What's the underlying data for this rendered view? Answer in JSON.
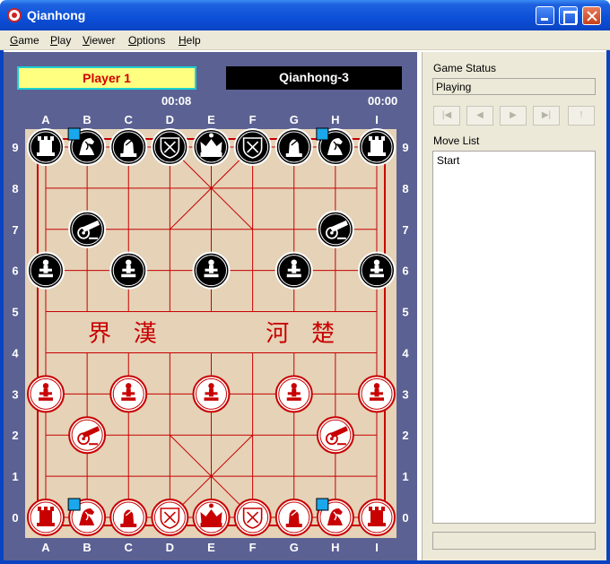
{
  "window": {
    "title": "Qianhong"
  },
  "menu": [
    {
      "pre": "",
      "key": "G",
      "post": "ame"
    },
    {
      "pre": "",
      "key": "P",
      "post": "lay"
    },
    {
      "pre": "",
      "key": "V",
      "post": "iewer"
    },
    {
      "pre": "",
      "key": "O",
      "post": "ptions"
    },
    {
      "pre": "",
      "key": "H",
      "post": "elp"
    }
  ],
  "players": {
    "red": {
      "name": "Player 1",
      "time": "00:08"
    },
    "black": {
      "name": "Qianhong-3",
      "time": "00:00"
    }
  },
  "board": {
    "files": [
      "A",
      "B",
      "C",
      "D",
      "E",
      "F",
      "G",
      "H",
      "I"
    ],
    "ranks": [
      "0",
      "1",
      "2",
      "3",
      "4",
      "5",
      "6",
      "7",
      "8",
      "9"
    ],
    "river_text": [
      "界",
      "漢",
      "河",
      "楚"
    ],
    "pieces": [
      {
        "side": "black",
        "type": "rook",
        "file": "A",
        "rank": "9"
      },
      {
        "side": "black",
        "type": "knight",
        "file": "B",
        "rank": "9"
      },
      {
        "side": "black",
        "type": "bishop",
        "file": "C",
        "rank": "9"
      },
      {
        "side": "black",
        "type": "guard",
        "file": "D",
        "rank": "9"
      },
      {
        "side": "black",
        "type": "king",
        "file": "E",
        "rank": "9"
      },
      {
        "side": "black",
        "type": "guard",
        "file": "F",
        "rank": "9"
      },
      {
        "side": "black",
        "type": "bishop",
        "file": "G",
        "rank": "9"
      },
      {
        "side": "black",
        "type": "knight",
        "file": "H",
        "rank": "9"
      },
      {
        "side": "black",
        "type": "rook",
        "file": "I",
        "rank": "9"
      },
      {
        "side": "black",
        "type": "cannon",
        "file": "B",
        "rank": "7"
      },
      {
        "side": "black",
        "type": "cannon",
        "file": "H",
        "rank": "7"
      },
      {
        "side": "black",
        "type": "pawn",
        "file": "A",
        "rank": "6"
      },
      {
        "side": "black",
        "type": "pawn",
        "file": "C",
        "rank": "6"
      },
      {
        "side": "black",
        "type": "pawn",
        "file": "E",
        "rank": "6"
      },
      {
        "side": "black",
        "type": "pawn",
        "file": "G",
        "rank": "6"
      },
      {
        "side": "black",
        "type": "pawn",
        "file": "I",
        "rank": "6"
      },
      {
        "side": "red",
        "type": "pawn",
        "file": "A",
        "rank": "3"
      },
      {
        "side": "red",
        "type": "pawn",
        "file": "C",
        "rank": "3"
      },
      {
        "side": "red",
        "type": "pawn",
        "file": "E",
        "rank": "3"
      },
      {
        "side": "red",
        "type": "pawn",
        "file": "G",
        "rank": "3"
      },
      {
        "side": "red",
        "type": "pawn",
        "file": "I",
        "rank": "3"
      },
      {
        "side": "red",
        "type": "cannon",
        "file": "B",
        "rank": "2"
      },
      {
        "side": "red",
        "type": "cannon",
        "file": "H",
        "rank": "2"
      },
      {
        "side": "red",
        "type": "rook",
        "file": "A",
        "rank": "0"
      },
      {
        "side": "red",
        "type": "knight",
        "file": "B",
        "rank": "0"
      },
      {
        "side": "red",
        "type": "bishop",
        "file": "C",
        "rank": "0"
      },
      {
        "side": "red",
        "type": "guard",
        "file": "D",
        "rank": "0"
      },
      {
        "side": "red",
        "type": "king",
        "file": "E",
        "rank": "0"
      },
      {
        "side": "red",
        "type": "guard",
        "file": "F",
        "rank": "0"
      },
      {
        "side": "red",
        "type": "bishop",
        "file": "G",
        "rank": "0"
      },
      {
        "side": "red",
        "type": "knight",
        "file": "H",
        "rank": "0"
      },
      {
        "side": "red",
        "type": "rook",
        "file": "I",
        "rank": "0"
      }
    ],
    "highlighted_pieces": [
      {
        "file": "B",
        "rank": "9"
      },
      {
        "file": "H",
        "rank": "9"
      },
      {
        "file": "B",
        "rank": "0"
      },
      {
        "file": "H",
        "rank": "0"
      }
    ]
  },
  "status": {
    "label": "Game Status",
    "value": "Playing",
    "nav_buttons": [
      "first-icon",
      "prev-icon",
      "next-icon",
      "last-icon",
      "exclamation-icon"
    ],
    "nav_glyphs": [
      "|◀",
      "◀",
      "▶",
      "▶|",
      "!"
    ],
    "move_list_label": "Move List",
    "moves": [
      "Start"
    ]
  },
  "colors": {
    "board": "#e5d2b7",
    "board_frame": "#5b6193",
    "red": "#c80000",
    "black_piece": "#000000",
    "highlight": "#1aa7ec",
    "title_bar": "#0c4fd8"
  }
}
